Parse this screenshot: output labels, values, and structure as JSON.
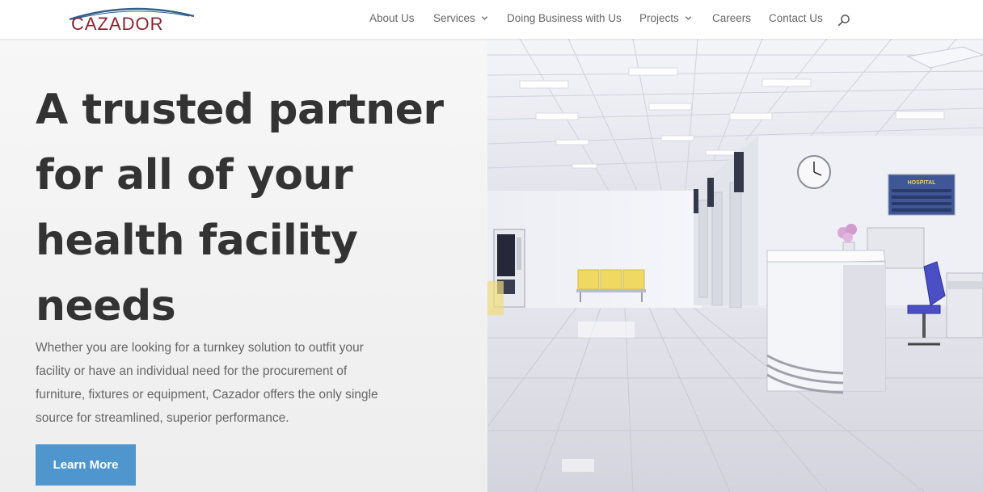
{
  "brand": {
    "logo_text": "CAZADOR"
  },
  "nav": {
    "items": [
      {
        "label": "About Us",
        "has_dropdown": false
      },
      {
        "label": "Services",
        "has_dropdown": true
      },
      {
        "label": "Doing Business with Us",
        "has_dropdown": false
      },
      {
        "label": "Projects",
        "has_dropdown": true
      },
      {
        "label": "Careers",
        "has_dropdown": false
      },
      {
        "label": "Contact Us",
        "has_dropdown": false
      }
    ],
    "search_icon": "search-icon"
  },
  "hero": {
    "title_lines": [
      "A trusted partner",
      "for all of your",
      "health facility",
      "needs"
    ],
    "body_lines": [
      "Whether you are looking for a turnkey solution to outfit your",
      "facility or have an individual need for the procurement of",
      "furniture, fixtures or equipment, Cazador offers the only single",
      "source for streamlined, superior performance."
    ],
    "cta_label": "Learn More"
  },
  "image": {
    "sign_title": "HOSPITAL"
  },
  "colors": {
    "brand_red": "#8a2430",
    "brand_blue": "#2f5f8f",
    "accent_button": "#4f96cf",
    "heading": "#333333",
    "body_text": "#666666"
  }
}
